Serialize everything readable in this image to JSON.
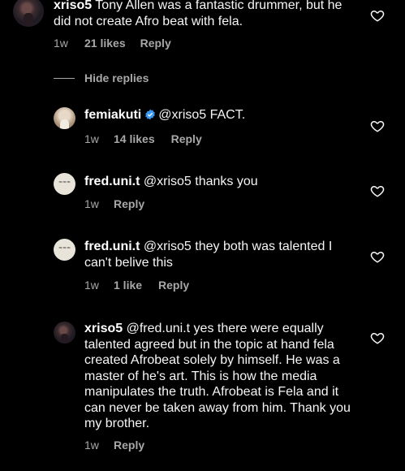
{
  "comments": [
    {
      "username": "xriso5",
      "text": " Tony Allen was a fantastic drummer, but he did not create Afro beat with fela.",
      "time": "1w",
      "likes": "21 likes",
      "reply": "Reply",
      "verified": false
    },
    {
      "username": "femiakuti",
      "text": "@xriso5 FACT.",
      "time": "1w",
      "likes": "14 likes",
      "reply": "Reply",
      "verified": true
    },
    {
      "username": "fred.uni.t",
      "text": "@xriso5 thanks you",
      "time": "1w",
      "likes": "",
      "reply": "Reply",
      "verified": false
    },
    {
      "username": "fred.uni.t",
      "text": "@xriso5 they both was talented I can't belive this",
      "time": "1w",
      "likes": "1 like",
      "reply": "Reply",
      "verified": false
    },
    {
      "username": "xriso5",
      "text": "@fred.uni.t yes there were equally talented agreed but in the topic at hand fela created Afrobeat solely by himself. He was a master of he's art. This is how the media manipulates the truth. Afrobeat is Fela and it can never be taken away from him. Thank you my brother.",
      "time": "1w",
      "likes": "",
      "reply": "Reply",
      "verified": false
    }
  ],
  "hide_replies_label": "Hide replies",
  "icons": {
    "like": "heart-outline-icon",
    "verified": "verified-badge-icon"
  },
  "colors": {
    "background": "#000000",
    "text": "#f5f5f5",
    "muted": "#a8a8a8",
    "verified": "#3897f0"
  }
}
